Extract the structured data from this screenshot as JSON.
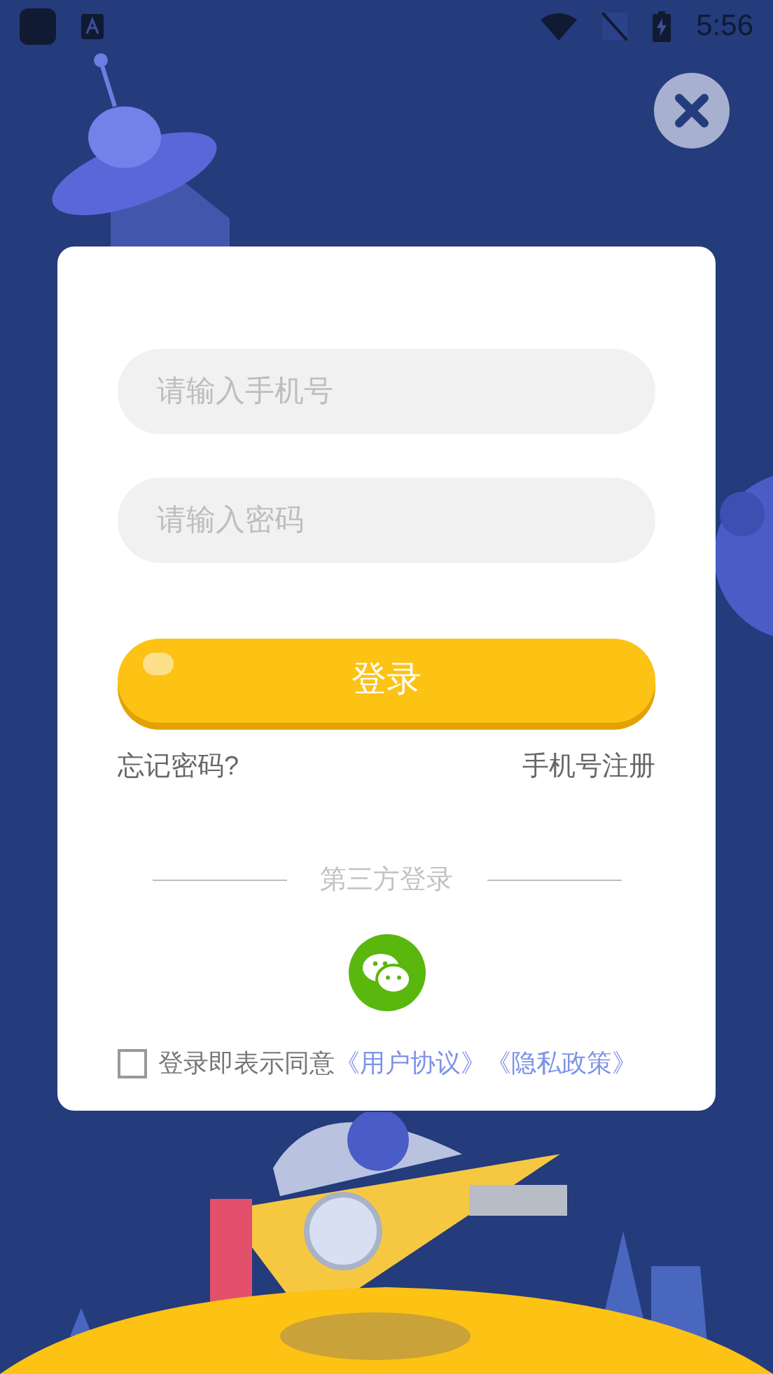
{
  "status_bar": {
    "time": "5:56"
  },
  "form": {
    "fields": [
      {
        "placeholder": "请输入手机号"
      },
      {
        "placeholder": "请输入密码"
      }
    ],
    "login_button": "登录",
    "forgot_link": "忘记密码?",
    "register_link": "手机号注册",
    "third_party_label": "第三方登录",
    "agreement": {
      "checked": false,
      "text": "登录即表示同意",
      "links": [
        "《用户协议》",
        "《隐私政策》"
      ]
    }
  }
}
